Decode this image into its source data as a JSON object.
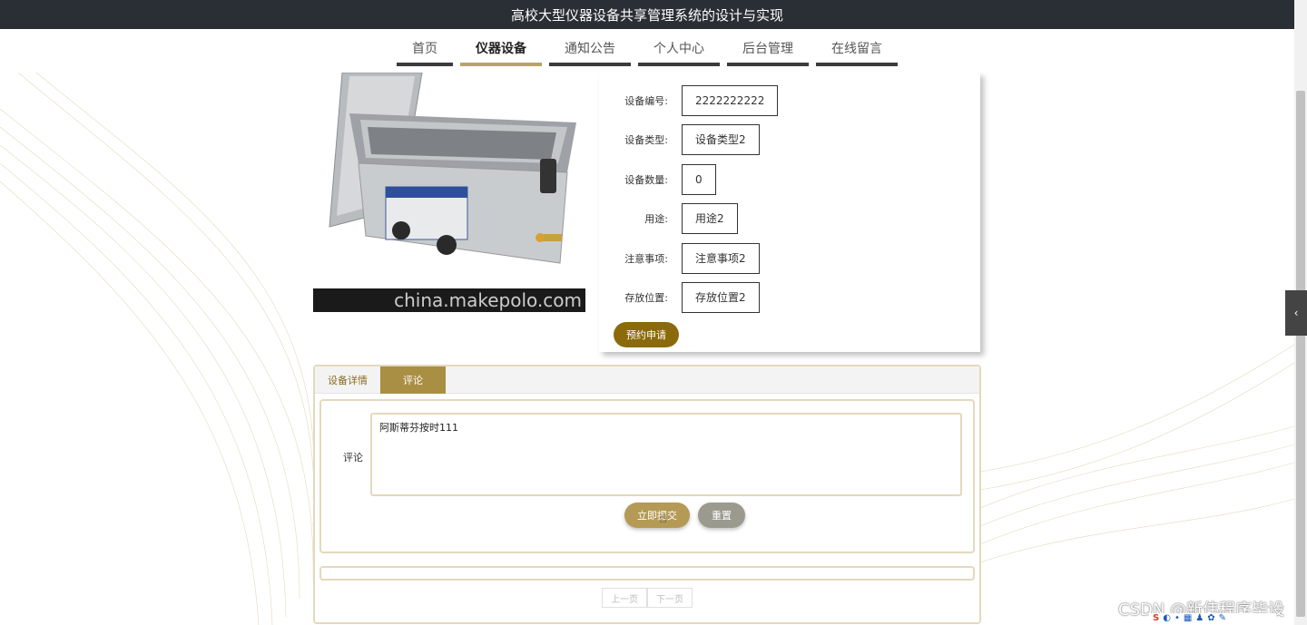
{
  "header": {
    "title": "高校大型仪器设备共享管理系统的设计与实现"
  },
  "nav": {
    "items": [
      {
        "label": "首页",
        "active": false
      },
      {
        "label": "仪器设备",
        "active": true
      },
      {
        "label": "通知公告",
        "active": false
      },
      {
        "label": "个人中心",
        "active": false
      },
      {
        "label": "后台管理",
        "active": false
      },
      {
        "label": "在线留言",
        "active": false
      }
    ]
  },
  "product": {
    "watermark": "china.makepolo.com"
  },
  "details": {
    "rows": [
      {
        "label": "设备编号:",
        "value": "2222222222"
      },
      {
        "label": "设备类型:",
        "value": "设备类型2"
      },
      {
        "label": "设备数量:",
        "value": "0"
      },
      {
        "label": "用途:",
        "value": "用途2"
      },
      {
        "label": "注意事项:",
        "value": "注意事项2"
      },
      {
        "label": "存放位置:",
        "value": "存放位置2"
      }
    ],
    "reserve_label": "预约申请"
  },
  "tabs": [
    {
      "label": "设备详情",
      "active": false
    },
    {
      "label": "评论",
      "active": true
    }
  ],
  "comment": {
    "label": "评论",
    "value": "阿斯蒂芬按时111",
    "submit_label": "立即提交",
    "reset_label": "重置"
  },
  "pager": {
    "prev_label": "上一页",
    "next_label": "下一页"
  },
  "overlay": {
    "csdn_watermark": "CSDN @新伟程序毕设"
  },
  "colors": {
    "accent": "#b8a368",
    "reserve": "#8a6a0b",
    "topbar": "#2a2e35"
  }
}
